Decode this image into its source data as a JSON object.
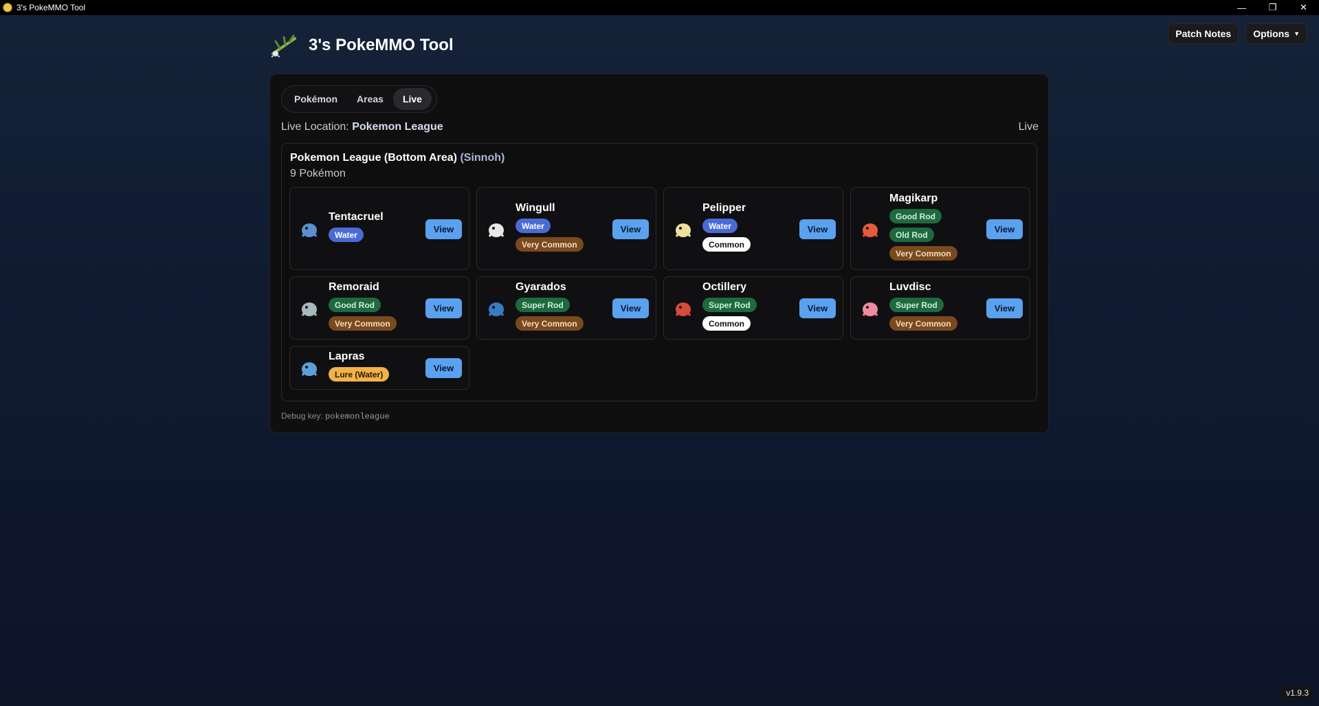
{
  "window": {
    "title": "3's PokeMMO Tool",
    "controls": [
      "—",
      "❐",
      "✕"
    ]
  },
  "header": {
    "app_title": "3's PokeMMO Tool",
    "patch_notes_label": "Patch Notes",
    "options_label": "Options"
  },
  "tabs": [
    {
      "label": "Pokémon",
      "active": false
    },
    {
      "label": "Areas",
      "active": false
    },
    {
      "label": "Live",
      "active": true
    }
  ],
  "live": {
    "location_prefix": "Live Location:",
    "location_name": "Pokemon League",
    "status": "Live"
  },
  "area": {
    "name": "Pokemon League (Bottom Area)",
    "region": "(Sinnoh)",
    "count_text": "9 Pokémon"
  },
  "pokemon": [
    {
      "name": "Tentacruel",
      "badges": [
        {
          "text": "Water",
          "kind": "water"
        }
      ],
      "view_label": "View",
      "sprite_color": "#5a8fd0"
    },
    {
      "name": "Wingull",
      "badges": [
        {
          "text": "Water",
          "kind": "water"
        },
        {
          "text": "Very Common",
          "kind": "brown"
        }
      ],
      "view_label": "View",
      "sprite_color": "#e8e8e8"
    },
    {
      "name": "Pelipper",
      "badges": [
        {
          "text": "Water",
          "kind": "water"
        },
        {
          "text": "Common",
          "kind": "white"
        }
      ],
      "view_label": "View",
      "sprite_color": "#f0e0a0"
    },
    {
      "name": "Magikarp",
      "badges": [
        {
          "text": "Good Rod",
          "kind": "green"
        },
        {
          "text": "Old Rod",
          "kind": "green"
        },
        {
          "text": "Very Common",
          "kind": "brown"
        }
      ],
      "view_label": "View",
      "sprite_color": "#e85a3a"
    },
    {
      "name": "Remoraid",
      "badges": [
        {
          "text": "Good Rod",
          "kind": "green"
        },
        {
          "text": "Very Common",
          "kind": "brown"
        }
      ],
      "view_label": "View",
      "sprite_color": "#a8b8c0"
    },
    {
      "name": "Gyarados",
      "badges": [
        {
          "text": "Super Rod",
          "kind": "green"
        },
        {
          "text": "Very Common",
          "kind": "brown"
        }
      ],
      "view_label": "View",
      "sprite_color": "#3a7ac0"
    },
    {
      "name": "Octillery",
      "badges": [
        {
          "text": "Super Rod",
          "kind": "green"
        },
        {
          "text": "Common",
          "kind": "white"
        }
      ],
      "view_label": "View",
      "sprite_color": "#d84a3a"
    },
    {
      "name": "Luvdisc",
      "badges": [
        {
          "text": "Super Rod",
          "kind": "green"
        },
        {
          "text": "Very Common",
          "kind": "brown"
        }
      ],
      "view_label": "View",
      "sprite_color": "#f08aa0"
    },
    {
      "name": "Lapras",
      "badges": [
        {
          "text": "Lure (Water)",
          "kind": "orange"
        }
      ],
      "view_label": "View",
      "sprite_color": "#5aa0d8"
    }
  ],
  "debug": {
    "label": "Debug key:",
    "key": "pokemonleague"
  },
  "version": "v1.9.3"
}
